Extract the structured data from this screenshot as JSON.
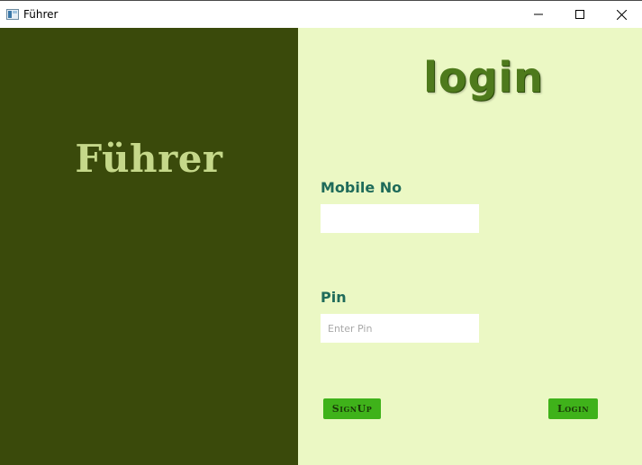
{
  "window": {
    "title": "Führer",
    "controls": {
      "minimize_icon": "minimize-icon",
      "maximize_icon": "maximize-icon",
      "close_icon": "close-icon"
    }
  },
  "left_panel": {
    "brand_text": "Führer",
    "background": "#3a4a0b",
    "text_color": "#c5d88a"
  },
  "right_panel": {
    "heading": "login",
    "background": "#ebf8c4",
    "mobile": {
      "label": "Mobile No",
      "value": "",
      "placeholder": ""
    },
    "pin": {
      "label": "Pin",
      "value": "",
      "placeholder": "Enter Pin"
    },
    "buttons": {
      "signup_label": "SignUp",
      "login_label": "Login",
      "color": "#3fb21a"
    }
  }
}
